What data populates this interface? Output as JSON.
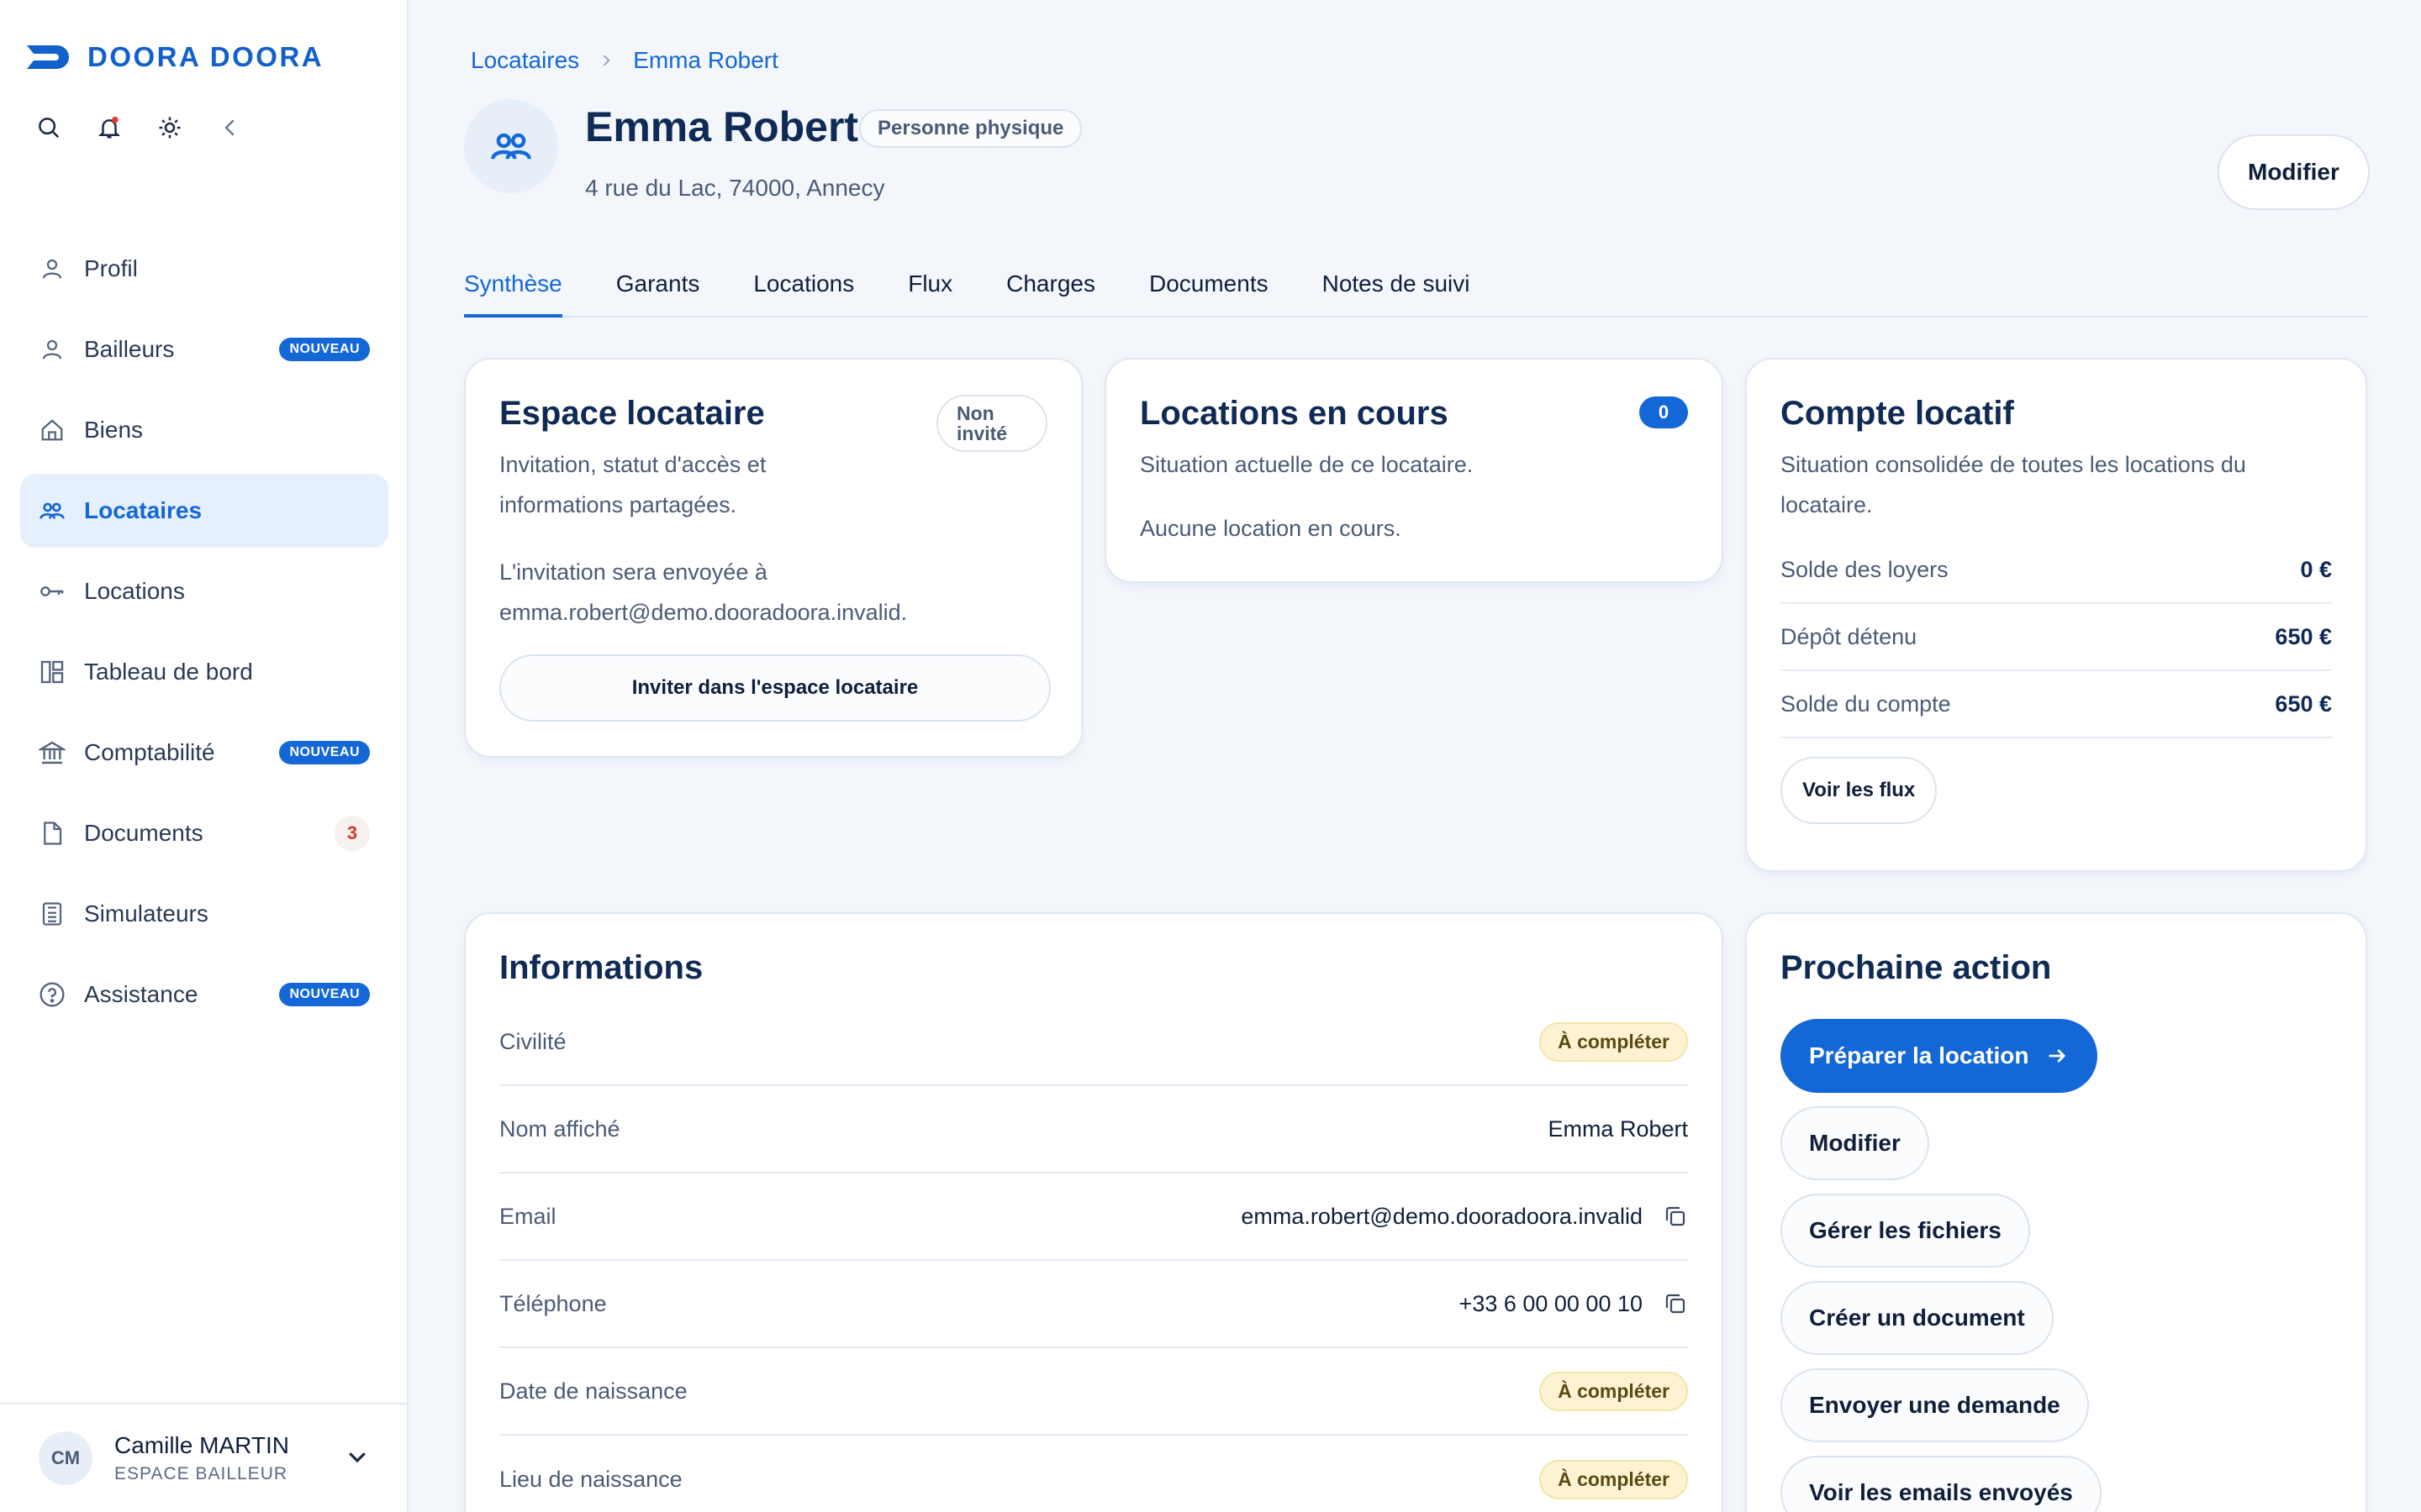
{
  "app": {
    "logo_text": "DOORA DOORA",
    "accent": "#1467d6"
  },
  "sidebar": {
    "items": [
      {
        "label": "Profil",
        "icon": "user-icon"
      },
      {
        "label": "Bailleurs",
        "icon": "user-icon",
        "badge": "NOUVEAU"
      },
      {
        "label": "Biens",
        "icon": "home-icon"
      },
      {
        "label": "Locataires",
        "icon": "users-icon",
        "active": true
      },
      {
        "label": "Locations",
        "icon": "key-icon"
      },
      {
        "label": "Tableau de bord",
        "icon": "dashboard-icon"
      },
      {
        "label": "Comptabilité",
        "icon": "bank-icon",
        "badge": "NOUVEAU"
      },
      {
        "label": "Documents",
        "icon": "document-icon",
        "count": "3"
      },
      {
        "label": "Simulateurs",
        "icon": "calculator-icon"
      },
      {
        "label": "Assistance",
        "icon": "help-icon",
        "badge": "NOUVEAU"
      }
    ],
    "user": {
      "initials": "CM",
      "name": "Camille MARTIN",
      "role": "ESPACE BAILLEUR"
    }
  },
  "breadcrumb": {
    "root": "Locataires",
    "current": "Emma Robert"
  },
  "header": {
    "title": "Emma Robert",
    "type_badge": "Personne physique",
    "address": "4 rue du Lac, 74000, Annecy",
    "modify_label": "Modifier"
  },
  "tabs": [
    "Synthèse",
    "Garants",
    "Locations",
    "Flux",
    "Charges",
    "Documents",
    "Notes de suivi"
  ],
  "espace": {
    "title": "Espace locataire",
    "status": "Non invité",
    "desc": "Invitation, statut d'accès et informations partagées.",
    "invite_text": "L'invitation sera envoyée à emma.robert@demo.dooradoora.invalid.",
    "button": "Inviter dans l'espace locataire"
  },
  "locations": {
    "title": "Locations en cours",
    "count": "0",
    "desc": "Situation actuelle de ce locataire.",
    "empty": "Aucune location en cours."
  },
  "compte": {
    "title": "Compte locatif",
    "desc": "Situation consolidée de toutes les locations du locataire.",
    "rows": [
      {
        "label": "Solde des loyers",
        "value": "0 €"
      },
      {
        "label": "Dépôt détenu",
        "value": "650 €"
      },
      {
        "label": "Solde du compte",
        "value": "650 €"
      }
    ],
    "button": "Voir les flux"
  },
  "informations": {
    "title": "Informations",
    "rows": [
      {
        "label": "Civilité",
        "value": "À compléter",
        "kind": "warn"
      },
      {
        "label": "Nom affiché",
        "value": "Emma Robert",
        "kind": "text"
      },
      {
        "label": "Email",
        "value": "emma.robert@demo.dooradoora.invalid",
        "kind": "copy"
      },
      {
        "label": "Téléphone",
        "value": "+33 6 00 00 00 10",
        "kind": "copy"
      },
      {
        "label": "Date de naissance",
        "value": "À compléter",
        "kind": "warn"
      },
      {
        "label": "Lieu de naissance",
        "value": "À compléter",
        "kind": "warn"
      }
    ]
  },
  "prochaine": {
    "title": "Prochaine action",
    "primary": "Préparer la location",
    "actions": [
      "Modifier",
      "Gérer les fichiers",
      "Créer un document",
      "Envoyer une demande",
      "Voir les emails envoyés"
    ]
  }
}
